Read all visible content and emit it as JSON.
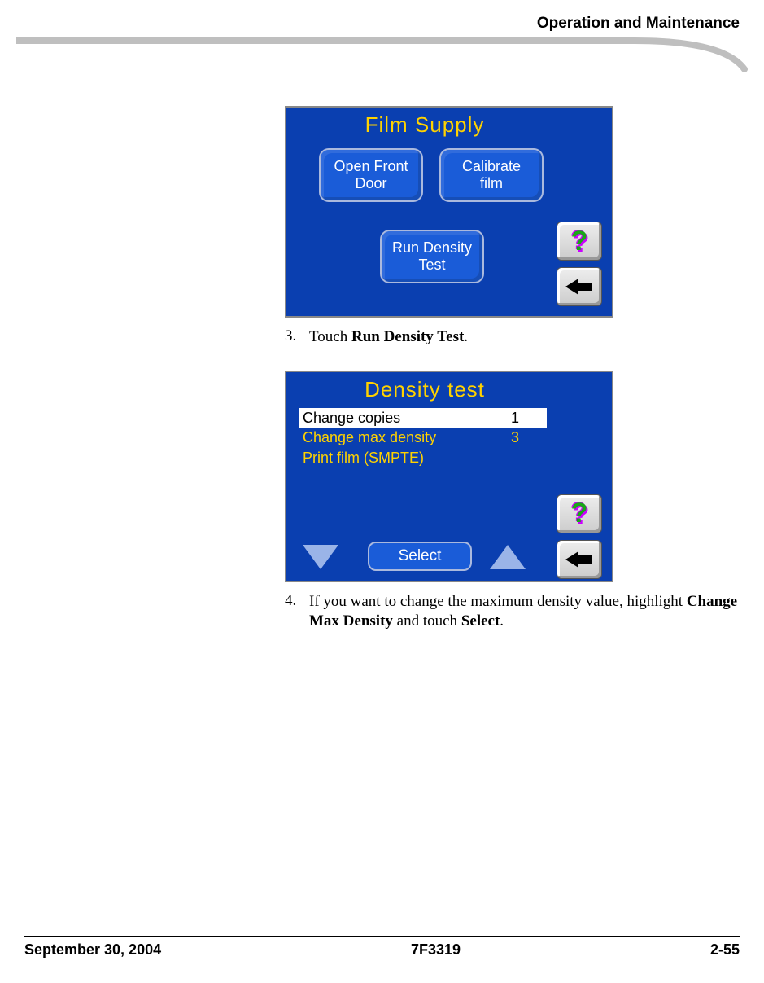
{
  "header": {
    "title": "Operation and Maintenance"
  },
  "screen1": {
    "title": "Film Supply",
    "btn_openfront": "Open Front\nDoor",
    "btn_calibrate": "Calibrate\nfilm",
    "btn_rundensity": "Run Density\nTest",
    "help": "?",
    "back_alt": "←"
  },
  "step3": {
    "num": "3.",
    "pre": "Touch ",
    "bold": "Run Density Test",
    "post": "."
  },
  "screen2": {
    "title": "Density test",
    "rows": [
      {
        "label": "Change copies",
        "value": "1",
        "hl": true
      },
      {
        "label": "Change max density",
        "value": "3",
        "hl": false
      },
      {
        "label": "Print film (SMPTE)",
        "value": "",
        "hl": false
      }
    ],
    "select": "Select",
    "help": "?",
    "back_alt": "←"
  },
  "step4": {
    "num": "4.",
    "pre": "If you want to change the maximum density value, highlight ",
    "bold1": "Change Max Density",
    "mid": " and touch ",
    "bold2": "Select",
    "post": "."
  },
  "footer": {
    "left": "September 30, 2004",
    "center": "7F3319",
    "right": "2-55"
  }
}
